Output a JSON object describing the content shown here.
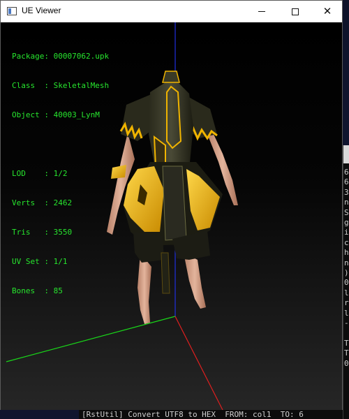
{
  "window": {
    "title": "UE Viewer"
  },
  "info": {
    "rows": [
      {
        "label": "Package: ",
        "value": "00007062.upk"
      },
      {
        "label": "Class  : ",
        "value": "SkeletalMesh"
      },
      {
        "label": "Object : ",
        "value": "40003_LynM"
      }
    ],
    "stats": [
      {
        "label": "LOD    : ",
        "value": "1/2"
      },
      {
        "label": "Verts  : ",
        "value": "2462"
      },
      {
        "label": "Tris   : ",
        "value": "3550"
      },
      {
        "label": "UV Set : ",
        "value": "1/1"
      },
      {
        "label": "Bones  : ",
        "value": "85"
      }
    ]
  },
  "console_right": [
    "6",
    "6",
    "3",
    "n",
    "S",
    "g",
    "i",
    "c",
    "h",
    "n",
    ")",
    "0",
    "l",
    "r",
    "l",
    "-",
    "",
    "T",
    "T",
    "0"
  ],
  "console_bottom": "[RstUtil] Convert UTF8 to HEX  FROM: col1  TO: 6",
  "desktop_glyph": "M",
  "colors": {
    "text_green": "#27e62e",
    "axis_green": "#19d619",
    "axis_red": "#e01f1f",
    "axis_blue": "#2030e0",
    "gold": "#f0b400"
  }
}
